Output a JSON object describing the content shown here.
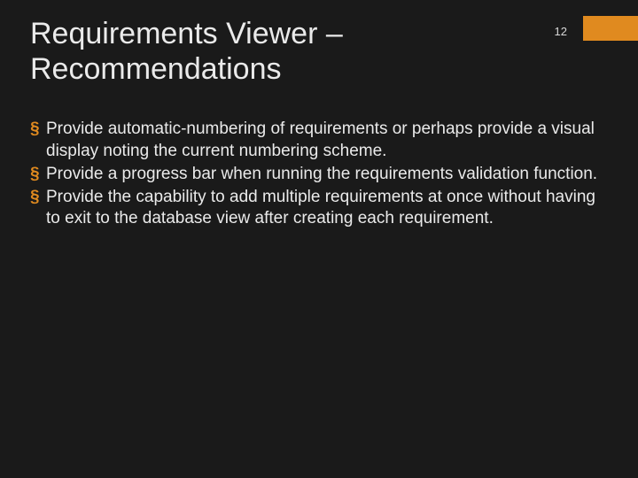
{
  "slide": {
    "title": "Requirements Viewer – Recommendations",
    "page_number": "12",
    "bullets": [
      "Provide automatic-numbering of requirements or perhaps provide a visual display noting the current numbering scheme.",
      "Provide a progress bar when running the requirements validation function.",
      "Provide the capability to add multiple requirements at once without having to exit to the database view after creating each requirement."
    ],
    "accent_color": "#e08a1f"
  }
}
